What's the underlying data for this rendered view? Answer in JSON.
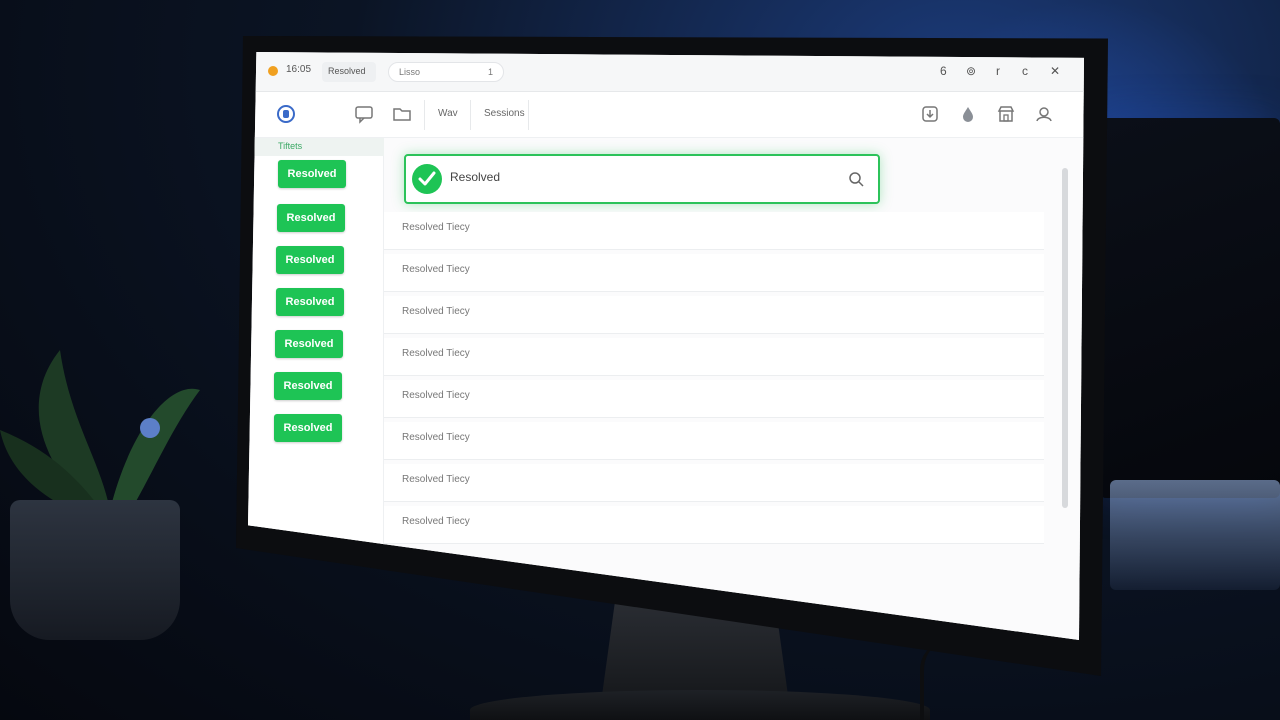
{
  "titlebar": {
    "time": "16:05",
    "app_label": "Resolved",
    "search_value": "Lisso",
    "search_clear": "1",
    "controls": [
      "6",
      "⊚",
      "r",
      "c",
      "✕"
    ]
  },
  "toolbar": {
    "items": [
      "Wav",
      "Sessions"
    ]
  },
  "sidebar": {
    "header": "Tiftets",
    "buttons": [
      "Resolved",
      "Resolved",
      "Resolved",
      "Resolved",
      "Resolved",
      "Resolved",
      "Resolved"
    ]
  },
  "search": {
    "value": "Resolved"
  },
  "rows": [
    "Resolved Tiecy",
    "Resolved Tiecy",
    "Resolved Tiecy",
    "Resolved Tiecy",
    "Resolved Tiecy",
    "Resolved Tiecy",
    "Resolved Tiecy",
    "Resolved Tiecy"
  ],
  "colors": {
    "accent_green": "#1ec455",
    "window_dot": "#f0a020"
  },
  "icons": [
    "app-logo-icon",
    "chat-icon",
    "folder-icon",
    "download-icon",
    "drop-icon",
    "store-icon",
    "user-icon",
    "search-icon",
    "check-icon"
  ]
}
